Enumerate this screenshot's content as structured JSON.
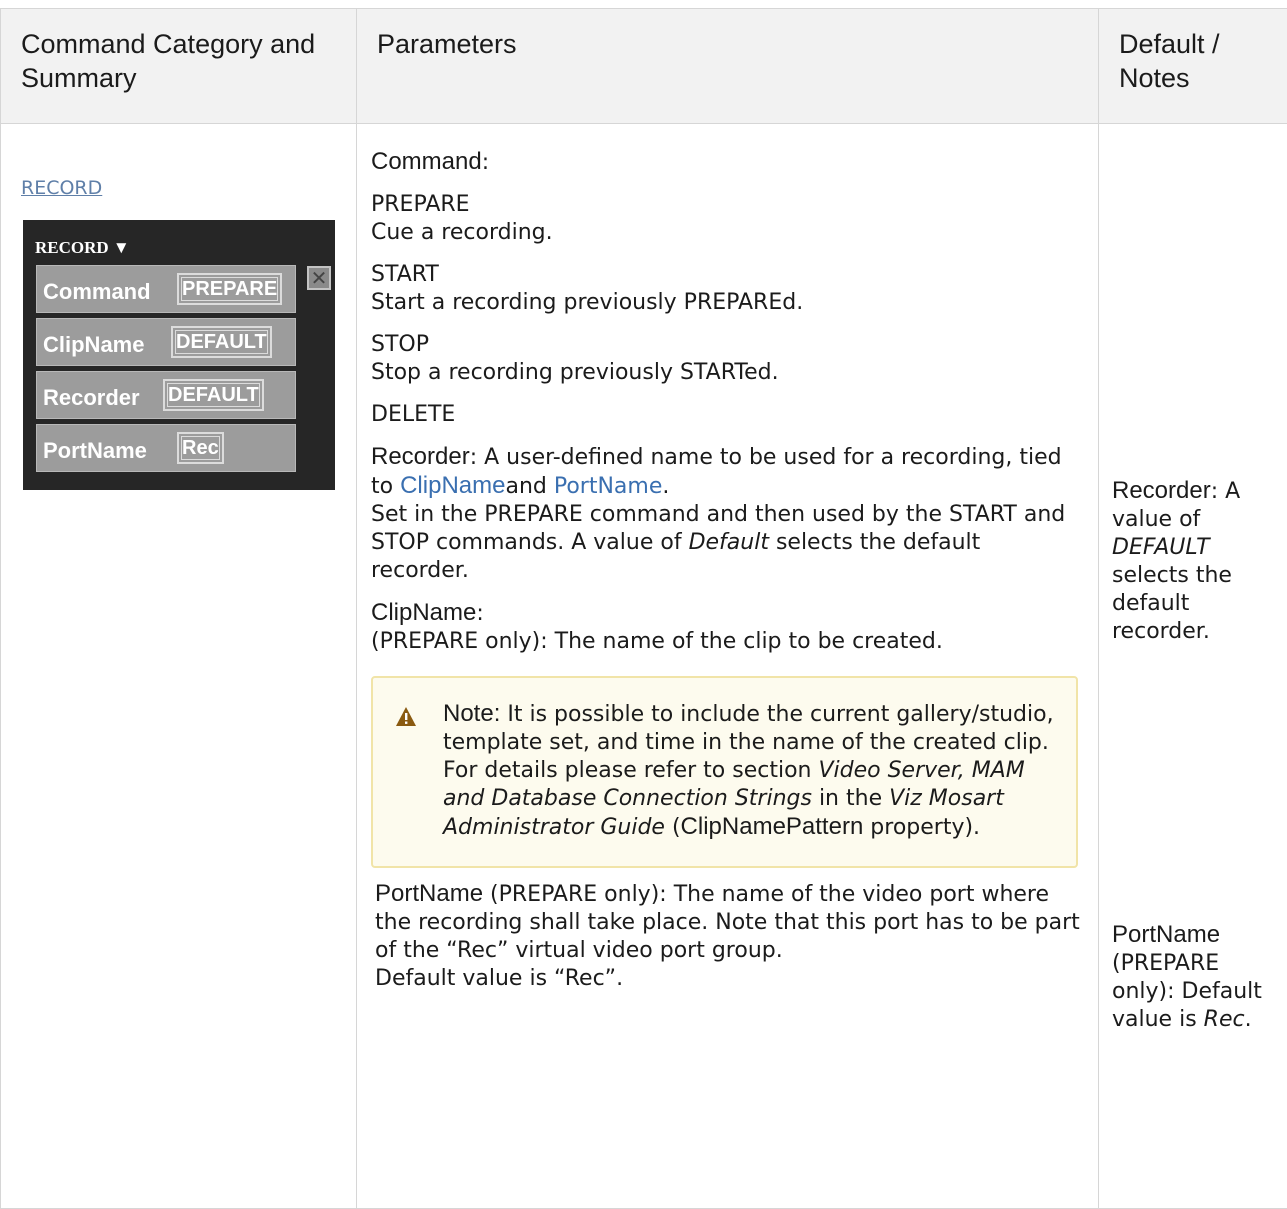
{
  "headers": {
    "col1": "Command Category and Summary",
    "col2": "Parameters",
    "col3": "Default / Notes"
  },
  "summary": {
    "link": "RECORD",
    "widget": {
      "title": "RECORD",
      "title_arrow": "▼",
      "rows": [
        {
          "label": "Command",
          "value": "PREPARE"
        },
        {
          "label": "ClipName",
          "value": "DEFAULT"
        },
        {
          "label": "Recorder",
          "value": "DEFAULT"
        },
        {
          "label": "PortName",
          "value": "Rec"
        }
      ],
      "close_glyph": "✕"
    }
  },
  "params": {
    "command_label": "Command",
    "command_colon": ":",
    "commands": [
      {
        "name": "PREPARE",
        "desc": "Cue a recording."
      },
      {
        "name": "START",
        "desc": "Start a recording previously PREPAREd."
      },
      {
        "name": "STOP",
        "desc": "Stop a recording previously STARTed."
      },
      {
        "name": "DELETE",
        "desc": ""
      }
    ],
    "recorder_label": "Recorder",
    "recorder_text1": ": A user-defined name to be used for a recording, tied to ",
    "clipname_link": "ClipName",
    "recorder_and": "and ",
    "portname_link": "PortName",
    "recorder_period": ".",
    "recorder_text2": "Set in the PREPARE command and then used by the START and STOP commands. A value of ",
    "recorder_italic": "Default",
    "recorder_text3": " selects the default recorder.",
    "clipname_label": "ClipName",
    "clipname_colon": ":",
    "clipname_text": "(PREPARE only): The name of the clip to be created.",
    "note": {
      "label": "Note:",
      "text1": " It is possible to include the current gallery/studio, template set, and time in the name of the created clip. For details please refer to section ",
      "italic1": "Video Server, MAM and Database Connection Strings",
      "text2": " in the ",
      "italic2": "Viz Mosart Administrator Guide",
      "text3": " (",
      "bold": "ClipNamePattern",
      "text4": " property)."
    },
    "portname_label": "PortName",
    "portname_text": " (PREPARE only): The name of the video port where the recording shall take place. Note that this port has to be part of the “Rec” virtual video port group.",
    "portname_default": "Default value is “Rec”."
  },
  "defaults": {
    "recorder_label": "Recorder",
    "recorder_text1": ": A value of ",
    "recorder_italic": "DEFAULT",
    "recorder_text2": " selects the default recorder.",
    "portname_label": "PortName",
    "portname_text1": " (PREPARE only): Default value is ",
    "portname_italic": "Rec",
    "portname_text2": "."
  }
}
